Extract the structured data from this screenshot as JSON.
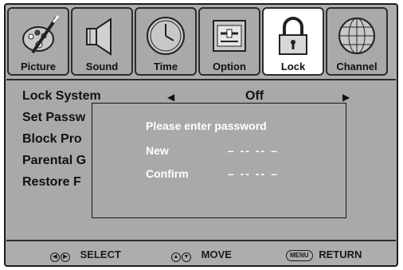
{
  "tabs": [
    {
      "label": "Picture",
      "icon": "picture-icon"
    },
    {
      "label": "Sound",
      "icon": "sound-icon"
    },
    {
      "label": "Time",
      "icon": "clock-icon"
    },
    {
      "label": "Option",
      "icon": "option-icon"
    },
    {
      "label": "Lock",
      "icon": "lock-icon",
      "active": true
    },
    {
      "label": "Channel",
      "icon": "globe-icon"
    }
  ],
  "menu": {
    "items": [
      "Lock System",
      "Set Passw",
      "Block Pro",
      "Parental G",
      "Restore F"
    ],
    "lock_system_value": "Off"
  },
  "dialog": {
    "title": "Please enter password",
    "new_label": "New",
    "new_value": "– -- -- –",
    "confirm_label": "Confirm",
    "confirm_value": "– -- -- –"
  },
  "footer": {
    "select_label": "SELECT",
    "move_label": "MOVE",
    "menu_key": "MENU",
    "return_label": "RETURN"
  },
  "colors": {
    "panel": "#a9a9a9",
    "active_tab": "#ffffff",
    "text": "#111111",
    "dialog_text": "#ffffff"
  }
}
